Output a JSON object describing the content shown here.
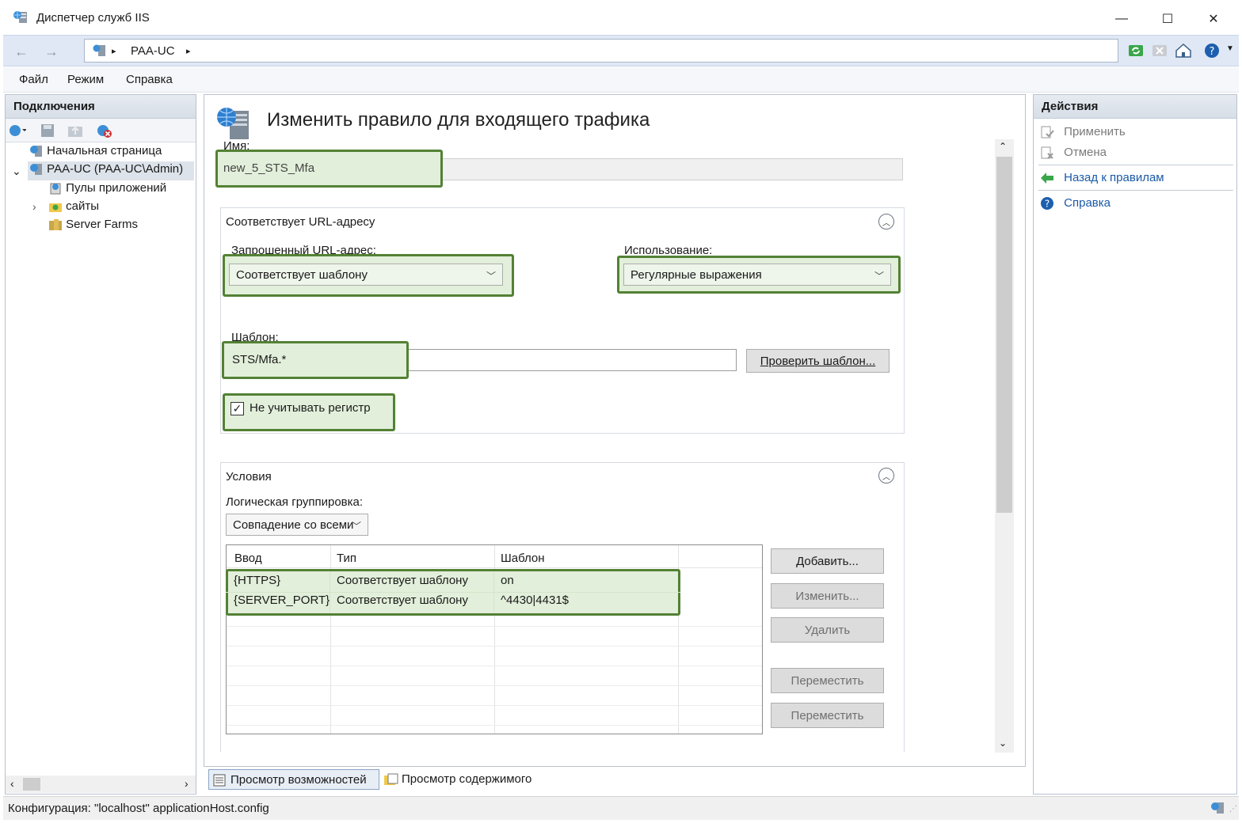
{
  "window": {
    "title": "Диспетчер служб IIS",
    "minimize": "—",
    "maximize": "☐",
    "close": "✕"
  },
  "address": {
    "back": "←",
    "forward": "→",
    "crumbs": [
      "PAA-UC"
    ],
    "sep": "▸"
  },
  "menu": {
    "file": "Файл",
    "view": "Режим",
    "help": "Справка"
  },
  "connections": {
    "header": "Подключения",
    "tree": [
      {
        "label": "Начальная страница",
        "icon": "start-page-icon"
      },
      {
        "label": "PAA-UC (PAA-UC\\Admin)",
        "icon": "server-icon",
        "expander": "⌄",
        "selected": true
      },
      {
        "label": "Пулы приложений",
        "icon": "app-pools-icon"
      },
      {
        "label": "сайты",
        "icon": "sites-icon",
        "expander": "›"
      },
      {
        "label": "Server Farms",
        "icon": "server-farms-icon"
      }
    ]
  },
  "page": {
    "heading": "Изменить правило для входящего трафика",
    "name_label": "Имя:",
    "name_value": "new_5_STS_Mfa",
    "match_group": {
      "title": "Соответствует URL-адресу",
      "requested_label": "Запрошенный URL-адрес:",
      "requested_value": "Соответствует шаблону",
      "using_label": "Использование:",
      "using_value": "Регулярные выражения",
      "pattern_label": "Шаблон:",
      "pattern_value": "STS/Mfa.*",
      "test_button": "Проверить шаблон...",
      "ignore_case": "Не учитывать регистр",
      "ignore_case_checked": true
    },
    "conditions": {
      "title": "Условия",
      "grouping_label": "Логическая группировка:",
      "grouping_value": "Совпадение со всеми",
      "columns": [
        "Ввод",
        "Тип",
        "Шаблон"
      ],
      "rows": [
        [
          "{HTTPS}",
          "Соответствует шаблону",
          "on"
        ],
        [
          "{SERVER_PORT}",
          "Соответствует шаблону",
          "^4430|4431$"
        ]
      ],
      "buttons": {
        "add": "Добавить...",
        "edit": "Изменить...",
        "remove": "Удалить",
        "move_up": "Переместить",
        "move_down": "Переместить"
      }
    }
  },
  "actions": {
    "header": "Действия",
    "apply": "Применить",
    "cancel": "Отмена",
    "back": "Назад к правилам",
    "help": "Справка"
  },
  "tabs": {
    "features": "Просмотр возможностей",
    "content": "Просмотр содержимого"
  },
  "status": {
    "text": "Конфигурация: \"localhost\" applicationHost.config"
  },
  "colors": {
    "highlight_border": "#538135",
    "highlight_fill": "#e2efda",
    "link": "#1a5aa6"
  }
}
